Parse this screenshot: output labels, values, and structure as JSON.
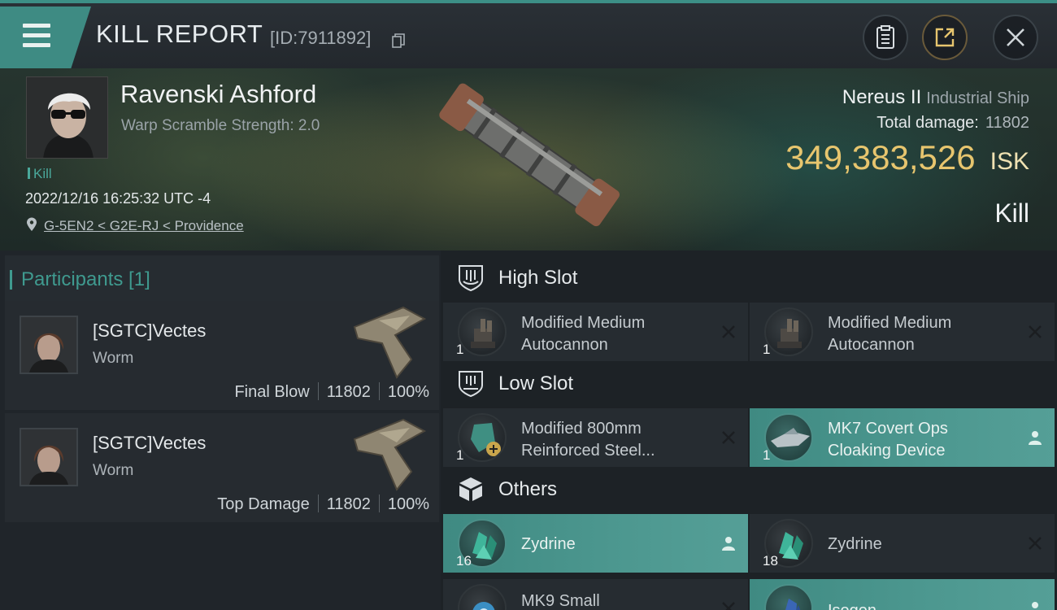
{
  "header": {
    "title": "KILL REPORT",
    "report_id": "[ID:7911892]",
    "icons": [
      "menu-icon",
      "copy-icon",
      "clipboard-icon",
      "share-icon",
      "close-icon"
    ]
  },
  "victim": {
    "name": "Ravenski Ashford",
    "warp_scramble": "Warp Scramble Strength: 2.0",
    "kill_tag": "Kill",
    "datetime": "2022/12/16 16:25:32 UTC -4",
    "location": "G-5EN2 < G2E-RJ < Providence",
    "ship_name": "Nereus II",
    "ship_class": "Industrial Ship",
    "total_damage_label": "Total damage:",
    "total_damage_value": "11802",
    "isk_value": "349,383,526",
    "isk_unit": "ISK",
    "result": "Kill"
  },
  "participants": {
    "header": "Participants [1]",
    "rows": [
      {
        "name": "[SGTC]Vectes",
        "ship": "Worm",
        "role": "Final Blow",
        "damage": "11802",
        "percent": "100%"
      },
      {
        "name": "[SGTC]Vectes",
        "ship": "Worm",
        "role": "Top Damage",
        "damage": "11802",
        "percent": "100%"
      }
    ]
  },
  "slots": {
    "high": {
      "label": "High Slot",
      "items": [
        {
          "name": "Modified Medium Autocannon",
          "qty": "1",
          "status": "destroyed"
        },
        {
          "name": "Modified Medium Autocannon",
          "qty": "1",
          "status": "destroyed"
        }
      ]
    },
    "low": {
      "label": "Low Slot",
      "items": [
        {
          "name": "Modified 800mm Reinforced Steel...",
          "qty": "1",
          "status": "destroyed"
        },
        {
          "name": "MK7 Covert Ops Cloaking Device",
          "qty": "1",
          "status": "dropped"
        }
      ]
    },
    "others": {
      "label": "Others",
      "items": [
        {
          "name": "Zydrine",
          "qty": "16",
          "status": "dropped"
        },
        {
          "name": "Zydrine",
          "qty": "18",
          "status": "destroyed"
        },
        {
          "name": "MK9 Small",
          "qty": "",
          "status": "destroyed"
        },
        {
          "name": "Isogen",
          "qty": "",
          "status": "dropped"
        }
      ]
    }
  },
  "colors": {
    "accent": "#3f8a82",
    "isk": "#e7c56e",
    "background": "#1d2226"
  }
}
